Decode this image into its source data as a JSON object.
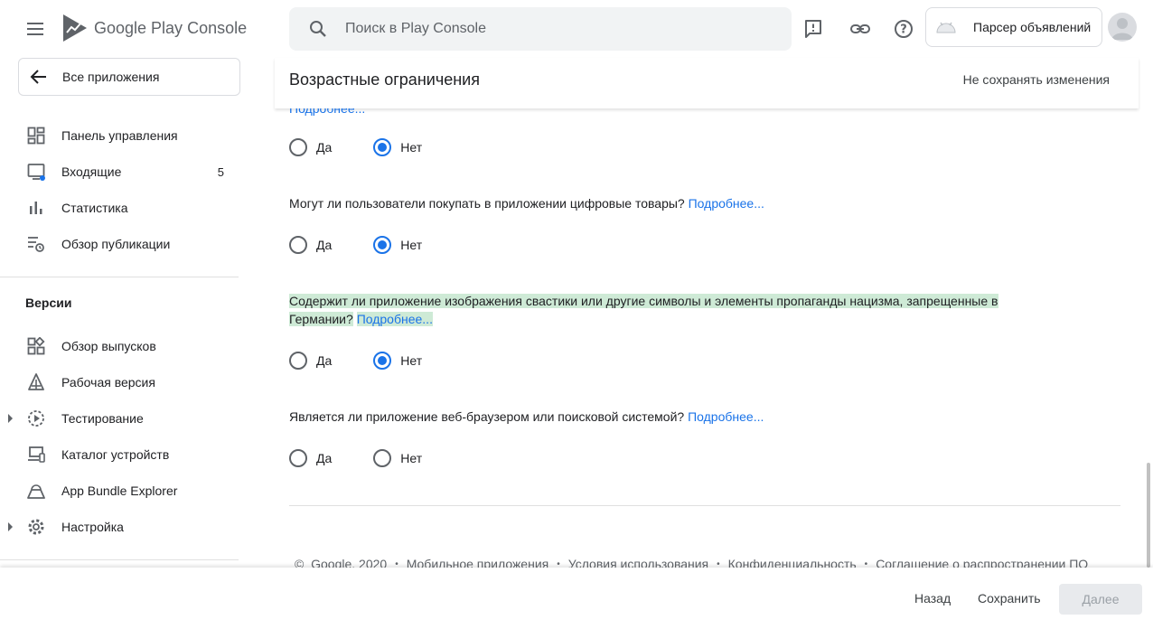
{
  "header": {
    "logo_text_1": "Google Play",
    "logo_text_2": "Console",
    "search_placeholder": "Поиск в Play Console",
    "account_name": "Парсер объявлений"
  },
  "sidebar": {
    "back_label": "Все приложения",
    "items_top": [
      {
        "label": "Панель управления",
        "icon": "dashboard-icon"
      },
      {
        "label": "Входящие",
        "icon": "inbox-icon",
        "count": "5"
      },
      {
        "label": "Статистика",
        "icon": "bar-chart-icon"
      },
      {
        "label": "Обзор публикации",
        "icon": "publishing-overview-icon"
      }
    ],
    "section_title": "Версии",
    "items_versions": [
      {
        "label": "Обзор выпусков",
        "icon": "releases-overview-icon"
      },
      {
        "label": "Рабочая версия",
        "icon": "production-icon"
      },
      {
        "label": "Тестирование",
        "icon": "testing-icon"
      },
      {
        "label": "Каталог устройств",
        "icon": "device-catalog-icon"
      },
      {
        "label": "App Bundle Explorer",
        "icon": "app-bundle-icon"
      },
      {
        "label": "Настройка",
        "icon": "settings-gear-icon"
      }
    ]
  },
  "page": {
    "title": "Возрастные ограничения",
    "discard_label": "Не сохранять изменения",
    "cut_link": "Подробнее...",
    "radio_yes": "Да",
    "radio_no": "Нет",
    "q1_selected": "no",
    "q2_text": "Могут ли пользователи покупать в приложении цифровые товары?",
    "q2_selected": "no",
    "q3_text": "Содержит ли приложение изображения свастики или другие символы и элементы пропаганды нацизма, запрещенные в Германии?",
    "q3_selected": "no",
    "q4_text": "Является ли приложение веб-браузером или поисковой системой?",
    "q4_selected": "none",
    "more_label": "Подробнее..."
  },
  "footer": {
    "copyright": "Google, 2020",
    "links": [
      "Мобильное приложения",
      "Условия использования",
      "Конфиденциальность",
      "Соглашение о распространении ПО"
    ]
  },
  "actions": {
    "back": "Назад",
    "save": "Сохранить",
    "next": "Далее"
  },
  "colors": {
    "accent": "#1a73e8",
    "highlight": "#ceead6"
  }
}
